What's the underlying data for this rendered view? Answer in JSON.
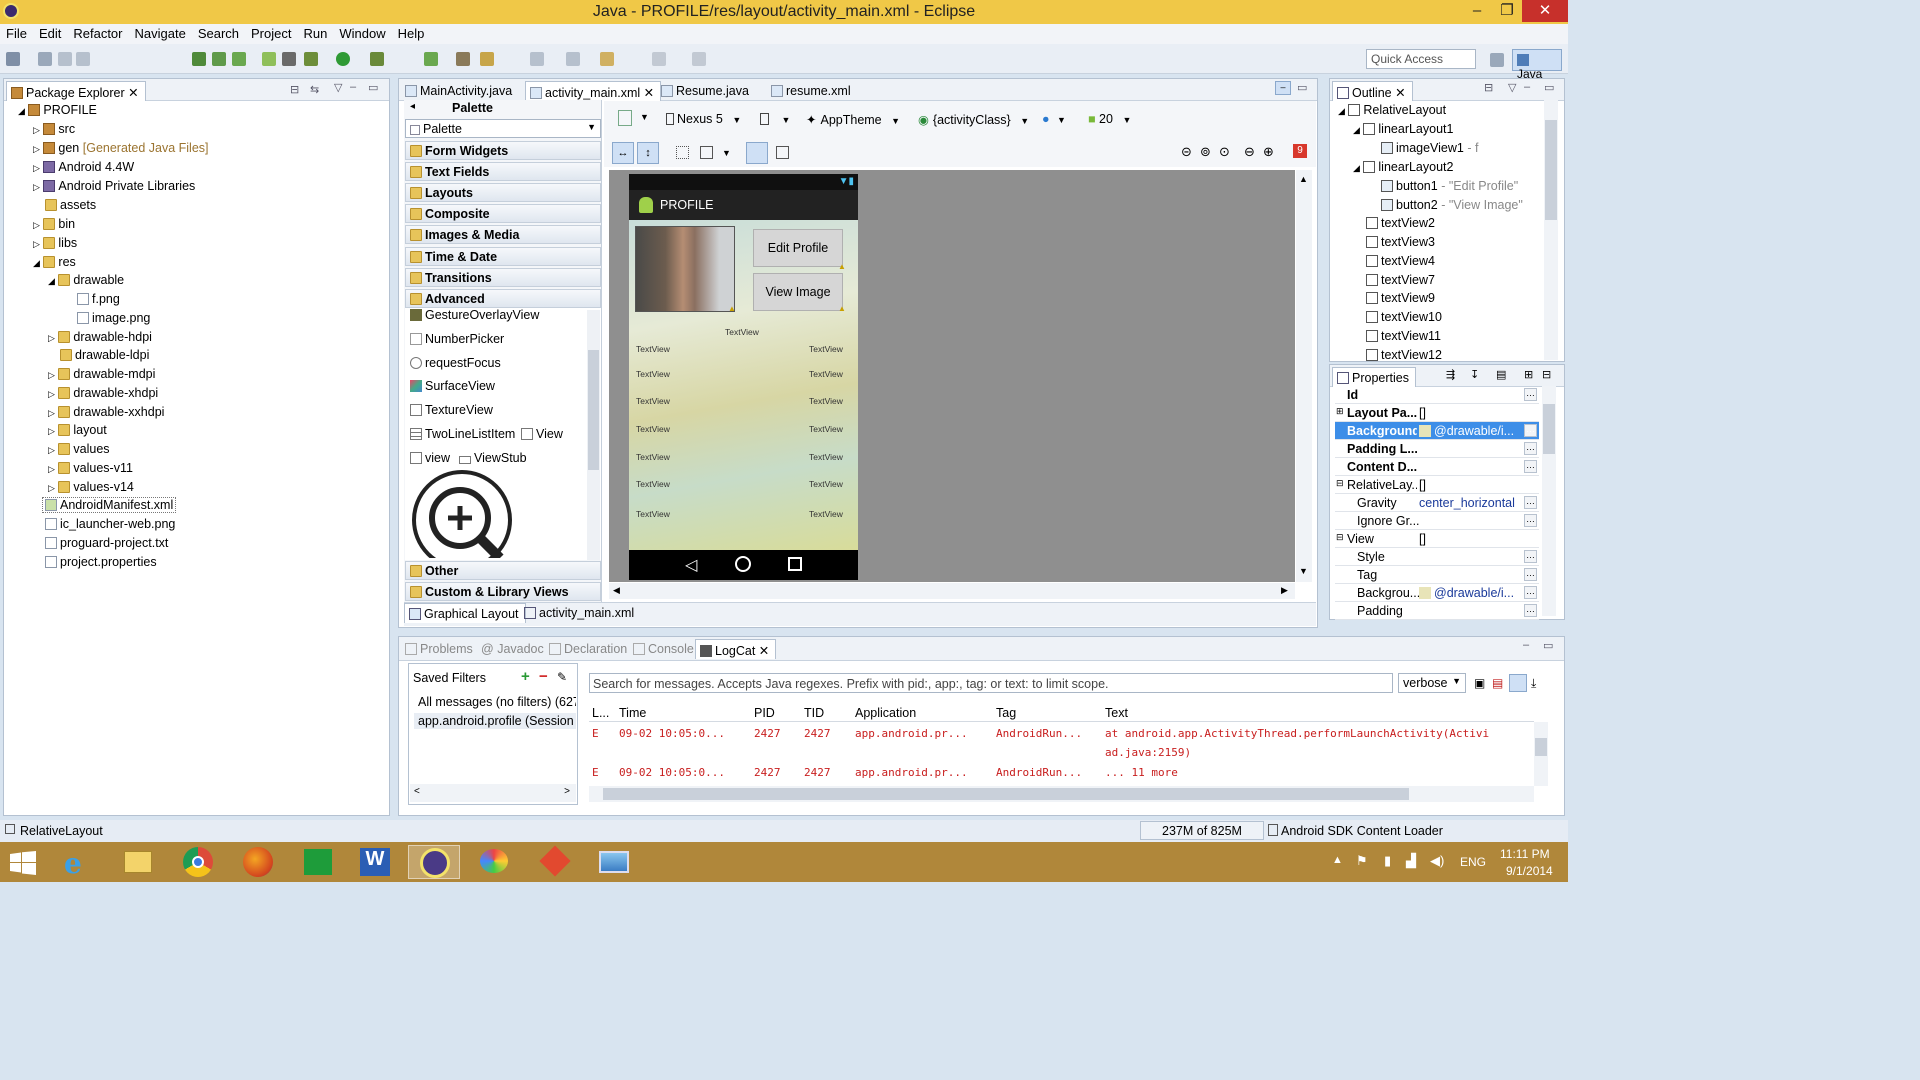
{
  "window": {
    "title": "Java - PROFILE/res/layout/activity_main.xml - Eclipse"
  },
  "menu": [
    "File",
    "Edit",
    "Refactor",
    "Navigate",
    "Search",
    "Project",
    "Run",
    "Window",
    "Help"
  ],
  "toolbar": {
    "quick_access_placeholder": "Quick Access",
    "perspective": "Java"
  },
  "explorer": {
    "tab": "Package Explorer",
    "project": "PROFILE",
    "items": [
      {
        "label": "src"
      },
      {
        "label": "gen",
        "suffix": "[Generated Java Files]"
      },
      {
        "label": "Android 4.4W"
      },
      {
        "label": "Android Private Libraries"
      },
      {
        "label": "assets"
      },
      {
        "label": "bin"
      },
      {
        "label": "libs"
      },
      {
        "label": "res"
      },
      {
        "label": "drawable"
      },
      {
        "label": "f.png"
      },
      {
        "label": "image.png"
      },
      {
        "label": "drawable-hdpi"
      },
      {
        "label": "drawable-ldpi"
      },
      {
        "label": "drawable-mdpi"
      },
      {
        "label": "drawable-xhdpi"
      },
      {
        "label": "drawable-xxhdpi"
      },
      {
        "label": "layout"
      },
      {
        "label": "values"
      },
      {
        "label": "values-v11"
      },
      {
        "label": "values-v14"
      },
      {
        "label": "AndroidManifest.xml"
      },
      {
        "label": "ic_launcher-web.png"
      },
      {
        "label": "proguard-project.txt"
      },
      {
        "label": "project.properties"
      }
    ]
  },
  "editor": {
    "tabs": [
      "MainActivity.java",
      "activity_main.xml",
      "Resume.java",
      "resume.xml"
    ],
    "palette_header": "Palette",
    "palette_combo": "Palette",
    "palette_categories_top": [
      "Form Widgets",
      "Text Fields",
      "Layouts",
      "Composite",
      "Images & Media",
      "Time & Date",
      "Transitions",
      "Advanced"
    ],
    "palette_items": [
      "GestureOverlayView",
      "NumberPicker",
      "requestFocus",
      "SurfaceView",
      "TextureView",
      "TwoLineListItem",
      "View",
      "view",
      "ViewStub"
    ],
    "palette_categories_bottom": [
      "Other",
      "Custom & Library Views"
    ],
    "device": "Nexus 5",
    "theme": "AppTheme",
    "activity": "{activityClass}",
    "api": "20",
    "bottom_tabs": [
      "Graphical Layout",
      "activity_main.xml"
    ]
  },
  "phone": {
    "app_title": "PROFILE",
    "btn_edit": "Edit Profile",
    "btn_view": "View Image",
    "textview": "TextView"
  },
  "outline": {
    "tab": "Outline",
    "items": [
      {
        "label": "RelativeLayout"
      },
      {
        "label": "linearLayout1"
      },
      {
        "label": "imageView1",
        "suffix": "- f"
      },
      {
        "label": "linearLayout2"
      },
      {
        "label": "button1",
        "suffix": "- \"Edit Profile\""
      },
      {
        "label": "button2",
        "suffix": "- \"View Image\""
      },
      {
        "label": "textView2"
      },
      {
        "label": "textView3"
      },
      {
        "label": "textView4"
      },
      {
        "label": "textView7"
      },
      {
        "label": "textView9"
      },
      {
        "label": "textView10"
      },
      {
        "label": "textView11"
      },
      {
        "label": "textView12"
      }
    ]
  },
  "properties": {
    "tab": "Properties",
    "rows": [
      {
        "key": "Id",
        "value": ""
      },
      {
        "key": "Layout Pa...",
        "value": "[]"
      },
      {
        "key": "Background",
        "value": "@drawable/i..."
      },
      {
        "key": "Padding L...",
        "value": ""
      },
      {
        "key": "Content D...",
        "value": ""
      },
      {
        "key": "RelativeLay...",
        "value": "[]"
      },
      {
        "key": "Gravity",
        "value": "center_horizontal"
      },
      {
        "key": "Ignore Gr...",
        "value": ""
      },
      {
        "key": "View",
        "value": "[]"
      },
      {
        "key": "Style",
        "value": ""
      },
      {
        "key": "Tag",
        "value": ""
      },
      {
        "key": "Backgrou...",
        "value": "@drawable/i..."
      },
      {
        "key": "Padding",
        "value": ""
      }
    ]
  },
  "console": {
    "tabs": [
      "Problems",
      "Javadoc",
      "Declaration",
      "Console",
      "LogCat"
    ],
    "saved_filters": "Saved Filters",
    "filters": [
      "All messages (no filters) (627",
      "app.android.profile (Session"
    ],
    "search_placeholder": "Search for messages. Accepts Java regexes. Prefix with pid:, app:, tag: or text: to limit scope.",
    "level": "verbose",
    "columns": [
      "L...",
      "Time",
      "PID",
      "TID",
      "Application",
      "Tag",
      "Text"
    ],
    "rows": [
      {
        "level": "E",
        "time": "09-02 10:05:0...",
        "pid": "2427",
        "tid": "2427",
        "app": "app.android.pr...",
        "tag": "AndroidRun...",
        "text": "at android.app.ActivityThread.performLaunchActivity(Activi",
        "cont": "ad.java:2159)"
      },
      {
        "level": "E",
        "time": "09-02 10:05:0...",
        "pid": "2427",
        "tid": "2427",
        "app": "app.android.pr...",
        "tag": "AndroidRun...",
        "text": "... 11 more",
        "cont": ""
      }
    ]
  },
  "status": {
    "selection": "RelativeLayout",
    "heap": "237M of 825M",
    "task": "Android SDK Content Loader"
  },
  "tray": {
    "lang": "ENG",
    "time": "11:11 PM",
    "date": "9/1/2014"
  }
}
